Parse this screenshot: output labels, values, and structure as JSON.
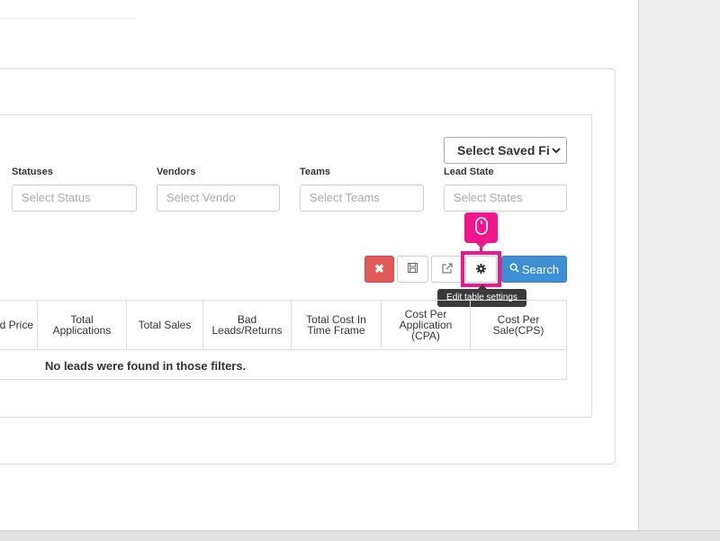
{
  "saved_filter": {
    "label": "Select Saved Fil"
  },
  "filters": [
    {
      "label": "Statuses",
      "placeholder": "Select Status"
    },
    {
      "label": "Vendors",
      "placeholder": "Select Vendo"
    },
    {
      "label": "Teams",
      "placeholder": "Select Teams"
    },
    {
      "label": "Lead State",
      "placeholder": "Select States"
    }
  ],
  "toolbar": {
    "clear_icon": "✖",
    "save_icon": "floppy-disk-icon",
    "export_icon": "external-link-icon",
    "settings_icon": "gear-icon",
    "search_label": "Search",
    "settings_tooltip": "Edit table settings"
  },
  "table": {
    "columns": [
      "d Price",
      "Total Applications",
      "Total Sales",
      "Bad Leads/Returns",
      "Total Cost In Time Frame",
      "Cost Per Application (CPA)",
      "Cost Per Sale(CPS)"
    ],
    "empty_message": "No leads were found in those filters."
  },
  "colors": {
    "highlight": "#f0178c",
    "search_button": "#3e8fd3",
    "clear_button": "#e05a5a"
  }
}
